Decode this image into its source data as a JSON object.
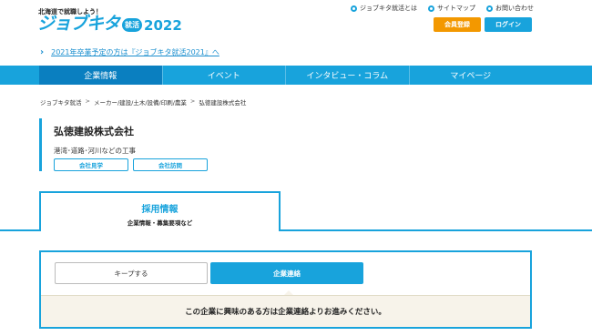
{
  "header": {
    "tagline": "北海道で就職しよう！",
    "logo_kana": "ジョブキタ",
    "logo_badge": "就活",
    "logo_year": "2022",
    "util_links": [
      "ジョブキタ就活とは",
      "サイトマップ",
      "お問い合わせ"
    ],
    "register_label": "会員登録",
    "login_label": "ログイン",
    "notice": "2021年卒業予定の方は『ジョブキタ就活2021』へ"
  },
  "nav": {
    "items": [
      "企業情報",
      "イベント",
      "インタビュー・コラム",
      "マイページ"
    ]
  },
  "breadcrumb": [
    "ジョブキタ就活",
    "メーカー/建設/土木/設備/印刷/農業",
    "弘徳建設株式会社"
  ],
  "company": {
    "name": "弘徳建設株式会社",
    "description": "港湾･道路･河川などの工事",
    "tags": [
      "会社見学",
      "会社訪問"
    ]
  },
  "recruit_tab": {
    "title": "採用情報",
    "subtitle": "企業情報・募集要項など"
  },
  "actions": {
    "keep_label": "キープする",
    "contact_label": "企業連絡",
    "message": "この企業に興味のある方は企業連絡よりお進みください。"
  },
  "colors": {
    "accent": "#18a3dc",
    "orange": "#f39800"
  }
}
